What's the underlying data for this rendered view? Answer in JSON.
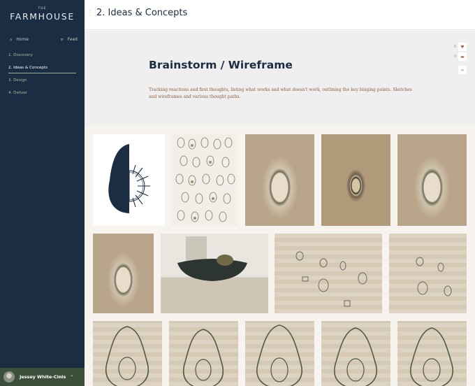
{
  "brand": {
    "the": "THE",
    "name": "FARMHOUSE"
  },
  "topnav": {
    "home": "Home",
    "feed": "Feed"
  },
  "nav": [
    {
      "label": "1. Discovery",
      "active": false
    },
    {
      "label": "2. Ideas & Concepts",
      "active": true
    },
    {
      "label": "3. Design",
      "active": false
    },
    {
      "label": "4. Deliver",
      "active": false
    }
  ],
  "user": {
    "name": "Jessey White-Cinis"
  },
  "header": {
    "title": "2. Ideas & Concepts"
  },
  "hero": {
    "title": "Brainstorm / Wireframe",
    "description": "Tracking reactions and first thoughts, listing what works and what doesn't work, outlining the key binging points. Sketches and wireframes and various thought paths."
  },
  "stats": {
    "likes": "0",
    "comments": "0"
  },
  "gallery_items": [
    "Half avocado graphic",
    "Avocado sketch sheet",
    "Avocado photo",
    "Avocado photo dark",
    "Avocado photo",
    "Avocado photo",
    "Avocado bowl photo",
    "Avocado pit sketches",
    "Avocado pit sketches",
    "Avocado sketch",
    "Avocado sketch",
    "Avocado sketch",
    "Avocado sketch",
    "Avocado sketch"
  ],
  "colors": {
    "sidebar": "#1b2d42",
    "accent": "#8fb389",
    "heart": "#b4674c"
  }
}
